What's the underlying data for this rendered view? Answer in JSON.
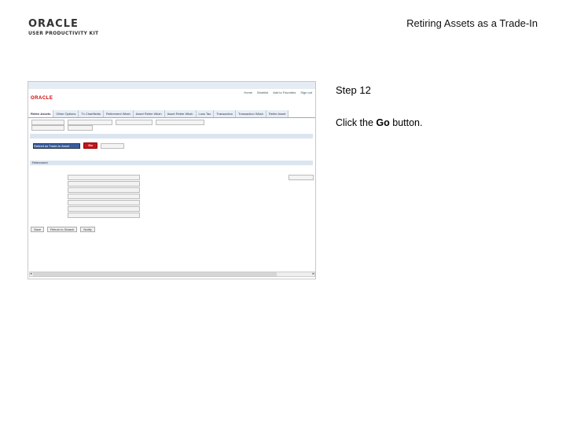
{
  "branding": {
    "logo_line1": "ORACLE",
    "logo_line2": "USER PRODUCTIVITY KIT"
  },
  "slide": {
    "title": "Retiring Assets as a Trade-In",
    "step": "Step 12",
    "instruction_prefix": "Click the ",
    "instruction_target": "Go",
    "instruction_suffix": " button."
  },
  "screenshot": {
    "top_links": [
      "Home",
      "Worklist",
      "Add to Favorites",
      "Sign out"
    ],
    "tabs": [
      "Retire Assets",
      "Other Options",
      "Tx Chartfields",
      "Retirement Wksh",
      "Asset Retire Wksh",
      "Asset Retire Wksh",
      "Loss Tax",
      "Transaction",
      "Transaction Wksh",
      "Retire Asset"
    ],
    "section_title": "Retirement",
    "go_label": "Go",
    "select_value": "Retired as Trade-In Asset",
    "buttons": [
      "Save",
      "Return to Search",
      "Notify"
    ]
  }
}
